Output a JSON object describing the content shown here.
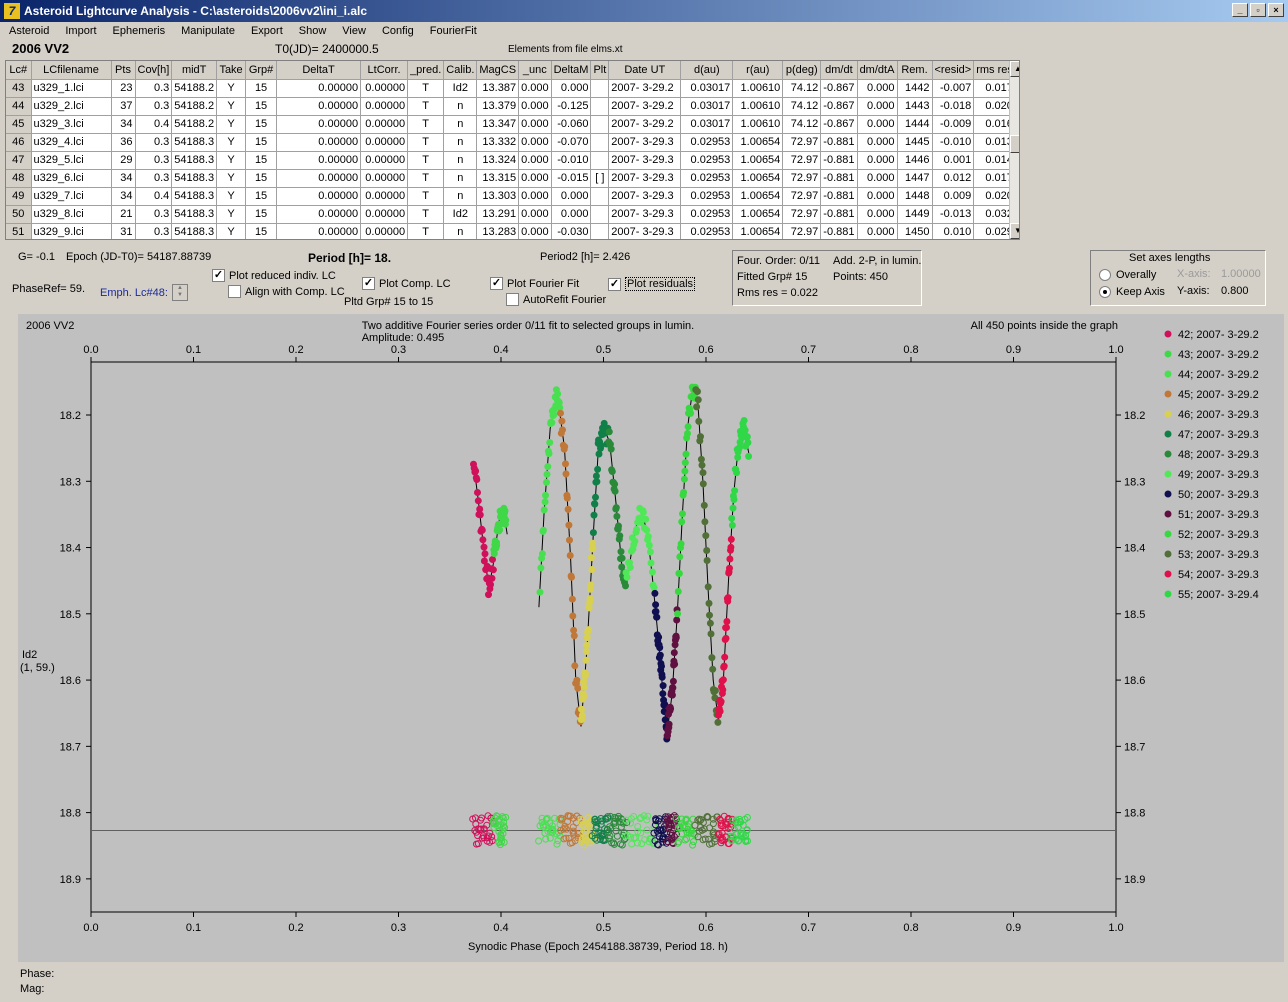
{
  "window": {
    "title": "Asteroid Lightcurve Analysis - C:\\asteroids\\2006vv2\\ini_i.alc",
    "min": "_",
    "max": "▫",
    "close": "×"
  },
  "menu": [
    "Asteroid",
    "Import",
    "Ephemeris",
    "Manipulate",
    "Export",
    "Show",
    "View",
    "Config",
    "FourierFit"
  ],
  "header": {
    "object": "2006 VV2",
    "t0": "T0(JD)= 2400000.5",
    "elements": "Elements from file elms.xt"
  },
  "table": {
    "columns": [
      "Lc#",
      "LCfilename",
      "Pts",
      "Cov[h]",
      "midT",
      "Take",
      "Grp#",
      "DeltaT",
      "LtCorr.",
      "_pred.",
      "Calib.",
      "MagCS",
      "_unc",
      "DeltaM",
      "Plt",
      "Date UT",
      "d(au)",
      "r(au)",
      "p(deg)",
      "dm/dt",
      "dm/dtA",
      "Rem.",
      "<resid>",
      "rms res"
    ],
    "rows": [
      [
        "43",
        "u329_1.lci",
        "23",
        "0.3",
        "54188.2",
        "Y",
        "15",
        "0.00000",
        "0.00000",
        "T",
        "Id2",
        "13.387",
        "0.000",
        "0.000",
        "",
        "2007- 3-29.2",
        "0.03017",
        "1.00610",
        "74.12",
        "-0.867",
        "0.000",
        "1442",
        "-0.007",
        "0.017"
      ],
      [
        "44",
        "u329_2.lci",
        "37",
        "0.3",
        "54188.2",
        "Y",
        "15",
        "0.00000",
        "0.00000",
        "T",
        "n",
        "13.379",
        "0.000",
        "-0.125",
        "",
        "2007- 3-29.2",
        "0.03017",
        "1.00610",
        "74.12",
        "-0.867",
        "0.000",
        "1443",
        "-0.018",
        "0.020"
      ],
      [
        "45",
        "u329_3.lci",
        "34",
        "0.4",
        "54188.2",
        "Y",
        "15",
        "0.00000",
        "0.00000",
        "T",
        "n",
        "13.347",
        "0.000",
        "-0.060",
        "",
        "2007- 3-29.2",
        "0.03017",
        "1.00610",
        "74.12",
        "-0.867",
        "0.000",
        "1444",
        "-0.009",
        "0.016"
      ],
      [
        "46",
        "u329_4.lci",
        "36",
        "0.3",
        "54188.3",
        "Y",
        "15",
        "0.00000",
        "0.00000",
        "T",
        "n",
        "13.332",
        "0.000",
        "-0.070",
        "",
        "2007- 3-29.3",
        "0.02953",
        "1.00654",
        "72.97",
        "-0.881",
        "0.000",
        "1445",
        "-0.010",
        "0.013"
      ],
      [
        "47",
        "u329_5.lci",
        "29",
        "0.3",
        "54188.3",
        "Y",
        "15",
        "0.00000",
        "0.00000",
        "T",
        "n",
        "13.324",
        "0.000",
        "-0.010",
        "",
        "2007- 3-29.3",
        "0.02953",
        "1.00654",
        "72.97",
        "-0.881",
        "0.000",
        "1446",
        "0.001",
        "0.014"
      ],
      [
        "48",
        "u329_6.lci",
        "34",
        "0.3",
        "54188.3",
        "Y",
        "15",
        "0.00000",
        "0.00000",
        "T",
        "n",
        "13.315",
        "0.000",
        "-0.015",
        "[ ]",
        "2007- 3-29.3",
        "0.02953",
        "1.00654",
        "72.97",
        "-0.881",
        "0.000",
        "1447",
        "0.012",
        "0.017"
      ],
      [
        "49",
        "u329_7.lci",
        "34",
        "0.4",
        "54188.3",
        "Y",
        "15",
        "0.00000",
        "0.00000",
        "T",
        "n",
        "13.303",
        "0.000",
        "0.000",
        "",
        "2007- 3-29.3",
        "0.02953",
        "1.00654",
        "72.97",
        "-0.881",
        "0.000",
        "1448",
        "0.009",
        "0.020"
      ],
      [
        "50",
        "u329_8.lci",
        "21",
        "0.3",
        "54188.3",
        "Y",
        "15",
        "0.00000",
        "0.00000",
        "T",
        "Id2",
        "13.291",
        "0.000",
        "0.000",
        "",
        "2007- 3-29.3",
        "0.02953",
        "1.00654",
        "72.97",
        "-0.881",
        "0.000",
        "1449",
        "-0.013",
        "0.032"
      ],
      [
        "51",
        "u329_9.lci",
        "31",
        "0.3",
        "54188.3",
        "Y",
        "15",
        "0.00000",
        "0.00000",
        "T",
        "n",
        "13.283",
        "0.000",
        "-0.030",
        "",
        "2007- 3-29.3",
        "0.02953",
        "1.00654",
        "72.97",
        "-0.881",
        "0.000",
        "1450",
        "0.010",
        "0.029"
      ]
    ]
  },
  "controls": {
    "g": "G= -0.1",
    "epoch": "Epoch (JD-T0)= 54187.88739",
    "period": "Period [h]= 18.",
    "period2": "Period2 [h]= 2.426",
    "phaseref": "PhaseRef= 59.",
    "emph": "Emph. Lc#48:",
    "plot_reduced": "Plot reduced indiv. LC",
    "align": "Align with Comp. LC",
    "plot_comp": "Plot Comp. LC",
    "pltd_grp": "Pltd Grp#  15 to   15",
    "plot_fourier": "Plot Fourier Fit",
    "autorefit": "AutoRefit Fourier",
    "plot_residuals": "Plot residuals",
    "checked": "✓"
  },
  "fourier_panel": {
    "order": "Four. Order:  0/11",
    "add": "Add. 2-P, in lumin.",
    "fitted": "Fitted Grp# 15",
    "points": "Points: 450",
    "rms": "Rms res      = 0.022"
  },
  "axes_panel": {
    "title": "Set axes lengths",
    "overally": "Overally",
    "keep": "Keep Axis",
    "xaxis_label": "X-axis:",
    "xaxis_value": "1.00000",
    "yaxis_label": "Y-axis:",
    "yaxis_value": "0.800"
  },
  "status": {
    "phase": "Phase:",
    "mag": "Mag:"
  },
  "chart_data": {
    "type": "scatter",
    "title": "Two additive Fourier series order 0/11 fit to selected groups in lumin.",
    "subtitle": "Amplitude: 0.495",
    "top_left": "2006 VV2",
    "top_right": "All 450 points inside the graph",
    "xlabel": "Synodic Phase (Epoch 2454188.38739, Period 18. h)",
    "ylabel": [
      "Id2",
      "(1, 59.)"
    ],
    "xlim": [
      0,
      1
    ],
    "ylim": [
      18.12,
      18.95
    ],
    "y_inverted": true,
    "xticks": [
      0,
      0.1,
      0.2,
      0.3,
      0.4,
      0.5,
      0.6,
      0.7,
      0.8,
      0.9,
      1.0
    ],
    "xtick_labels": [
      "0.0",
      "0.1",
      "0.2",
      "0.3",
      "0.4",
      "0.5",
      "0.6",
      "0.7",
      "0.8",
      "0.9",
      "1.0"
    ],
    "yticks": [
      18.2,
      18.3,
      18.4,
      18.5,
      18.6,
      18.7,
      18.8,
      18.9
    ],
    "ytick_labels": [
      "18.2",
      "18.3",
      "18.4",
      "18.5",
      "18.6",
      "18.7",
      "18.8",
      "18.9"
    ],
    "residual_baseline": 18.827,
    "legend_position": "right",
    "series": [
      {
        "name": "42; 2007- 3-29.2",
        "color": "#d0105a",
        "range": [
          0.373,
          0.393
        ]
      },
      {
        "name": "43; 2007- 3-29.2",
        "color": "#40d848",
        "range": [
          0.393,
          0.405
        ]
      },
      {
        "name": "44; 2007- 3-29.2",
        "color": "#48e050",
        "range": [
          0.438,
          0.458
        ]
      },
      {
        "name": "45; 2007- 3-29.2",
        "color": "#c07838",
        "range": [
          0.458,
          0.478
        ]
      },
      {
        "name": "46; 2007- 3-29.3",
        "color": "#d8d050",
        "range": [
          0.478,
          0.49
        ]
      },
      {
        "name": "47; 2007- 3-29.3",
        "color": "#108048",
        "range": [
          0.49,
          0.505
        ]
      },
      {
        "name": "48; 2007- 3-29.3",
        "color": "#2a8a3a",
        "range": [
          0.505,
          0.522
        ]
      },
      {
        "name": "49; 2007- 3-29.3",
        "color": "#50e858",
        "range": [
          0.522,
          0.55
        ]
      },
      {
        "name": "50; 2007- 3-29.3",
        "color": "#101050",
        "range": [
          0.55,
          0.562
        ]
      },
      {
        "name": "51; 2007- 3-29.3",
        "color": "#601040",
        "range": [
          0.562,
          0.572
        ]
      },
      {
        "name": "52; 2007- 3-29.3",
        "color": "#38d840",
        "range": [
          0.572,
          0.59
        ]
      },
      {
        "name": "53; 2007- 3-29.3",
        "color": "#507038",
        "range": [
          0.59,
          0.612
        ]
      },
      {
        "name": "54; 2007- 3-29.3",
        "color": "#e0104a",
        "range": [
          0.612,
          0.625
        ]
      },
      {
        "name": "55; 2007- 3-29.4",
        "color": "#30d848",
        "range": [
          0.625,
          0.642
        ]
      }
    ],
    "fit_curve": {
      "color": "#000000",
      "points": [
        [
          0.373,
          18.27
        ],
        [
          0.378,
          18.33
        ],
        [
          0.383,
          18.4
        ],
        [
          0.388,
          18.46
        ],
        [
          0.392,
          18.43
        ],
        [
          0.398,
          18.36
        ],
        [
          0.403,
          18.35
        ],
        [
          0.406,
          18.38
        ]
      ],
      "segment2": [
        [
          0.437,
          18.49
        ],
        [
          0.442,
          18.35
        ],
        [
          0.448,
          18.22
        ],
        [
          0.455,
          18.17
        ],
        [
          0.462,
          18.25
        ],
        [
          0.468,
          18.42
        ],
        [
          0.473,
          18.6
        ],
        [
          0.478,
          18.67
        ],
        [
          0.484,
          18.55
        ],
        [
          0.49,
          18.38
        ],
        [
          0.495,
          18.25
        ],
        [
          0.5,
          18.22
        ],
        [
          0.506,
          18.24
        ],
        [
          0.512,
          18.33
        ],
        [
          0.518,
          18.43
        ],
        [
          0.523,
          18.45
        ],
        [
          0.528,
          18.4
        ],
        [
          0.533,
          18.36
        ],
        [
          0.538,
          18.35
        ],
        [
          0.543,
          18.38
        ],
        [
          0.548,
          18.45
        ],
        [
          0.553,
          18.53
        ],
        [
          0.558,
          18.62
        ],
        [
          0.562,
          18.68
        ],
        [
          0.567,
          18.62
        ],
        [
          0.572,
          18.5
        ],
        [
          0.577,
          18.35
        ],
        [
          0.582,
          18.22
        ],
        [
          0.587,
          18.16
        ],
        [
          0.592,
          18.18
        ],
        [
          0.597,
          18.3
        ],
        [
          0.602,
          18.46
        ],
        [
          0.607,
          18.6
        ],
        [
          0.612,
          18.66
        ],
        [
          0.617,
          18.6
        ],
        [
          0.622,
          18.45
        ],
        [
          0.627,
          18.32
        ],
        [
          0.632,
          18.24
        ],
        [
          0.637,
          18.22
        ],
        [
          0.642,
          18.26
        ]
      ]
    }
  }
}
